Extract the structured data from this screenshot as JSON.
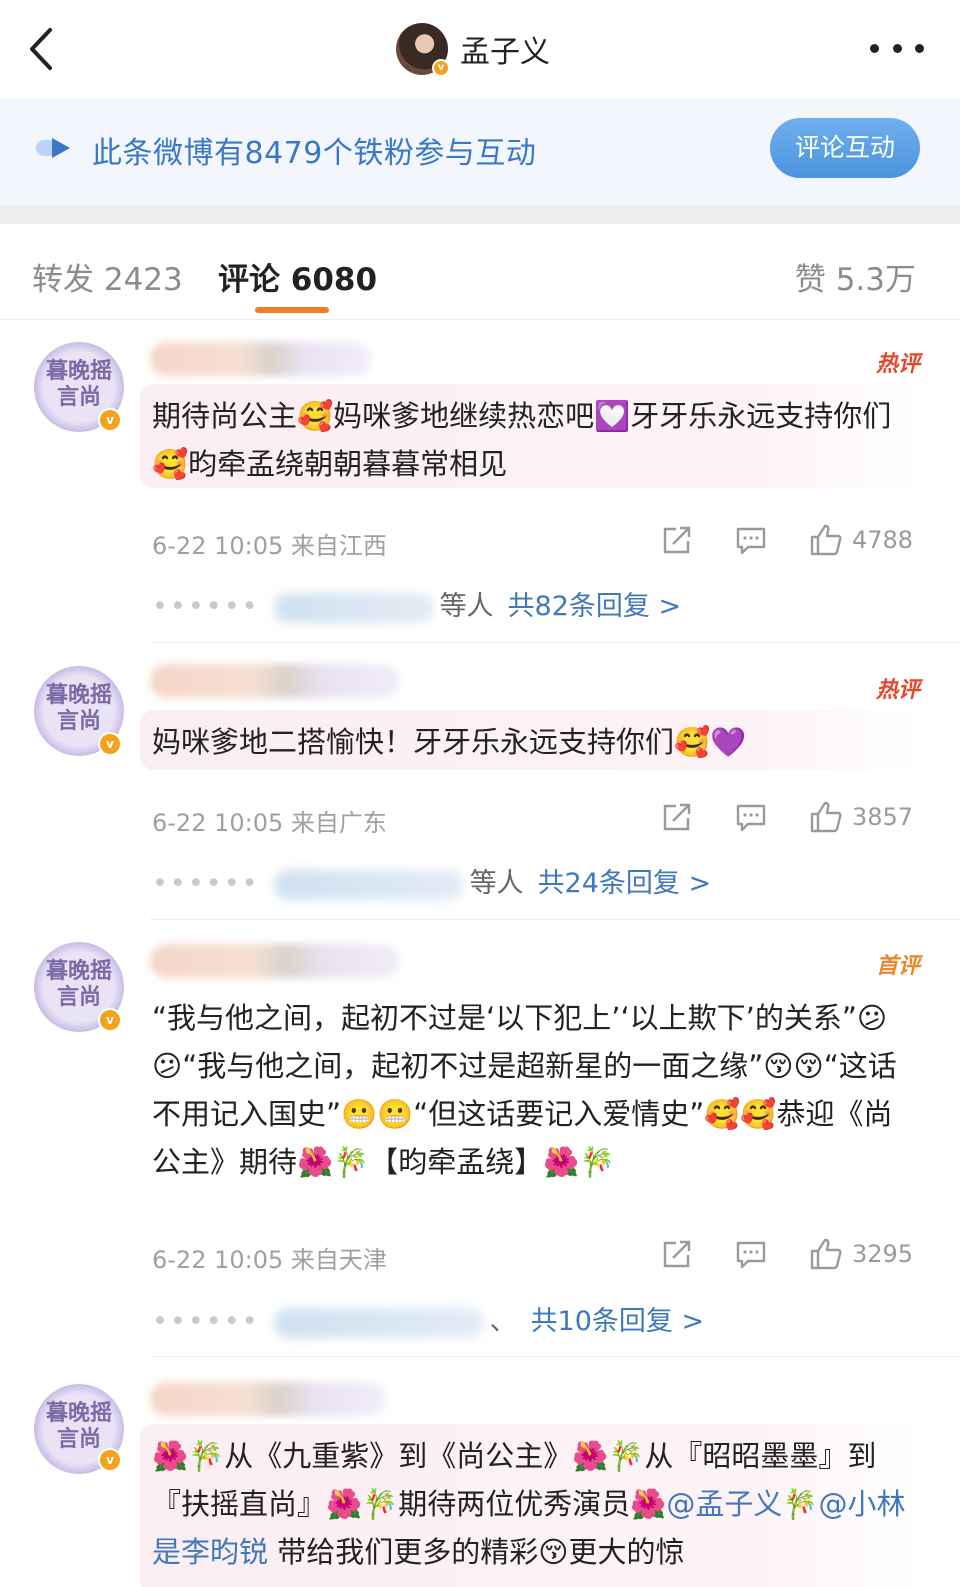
{
  "header": {
    "title": "孟子义"
  },
  "banner": {
    "text": "此条微博有8479个铁粉参与互动",
    "button_label": "评论互动"
  },
  "tabs": {
    "forward": "转发 2423",
    "comments": "评论 6080",
    "likes": "赞 5.3万"
  },
  "comments": [
    {
      "avatar_text": "暮晚摇\n言尚",
      "tag": "热评",
      "body": "期待尚公主🥰妈咪爹地继续热恋吧💟牙牙乐永远支持你们🥰昀牵孟绕朝朝暮暮常相见",
      "meta": "6-22 10:05 来自江西",
      "likes": "4788",
      "reply_suffix": "等人",
      "reply_link": "共82条回复 >"
    },
    {
      "avatar_text": "暮晚摇\n言尚",
      "tag": "热评",
      "body": "妈咪爹地二搭愉快！牙牙乐永远支持你们🥰💜",
      "meta": "6-22 10:05 来自广东",
      "likes": "3857",
      "reply_suffix": "等人",
      "reply_link": "共24条回复 >"
    },
    {
      "avatar_text": "暮晚摇\n言尚",
      "tag": "首评",
      "body": "“我与他之间，起初不过是‘以下犯上’‘以上欺下’的关系”😕😕“我与他之间，起初不过是超新星的一面之缘”😚😚“这话不用记入国史”😬😬“但这话要记入爱情史”🥰🥰恭迎《尚公主》期待🌺🎋【昀牵孟绕】🌺🎋",
      "meta": "6-22 10:05 来自天津",
      "likes": "3295",
      "reply_suffix": "、",
      "reply_link": "共10条回复 >"
    },
    {
      "avatar_text": "暮晚摇\n言尚",
      "body_part1": "🌺🎋从《九重紫》到《尚公主》🌺🎋从『昭昭墨墨』到『扶摇直尚』🌺🎋期待两位优秀演员🌺",
      "mention1": "@孟子义",
      "body_part2": "🎋",
      "mention2": "@小林是李昀锐",
      "body_part3": " 带给我们更多的精彩😚更大的惊"
    }
  ]
}
